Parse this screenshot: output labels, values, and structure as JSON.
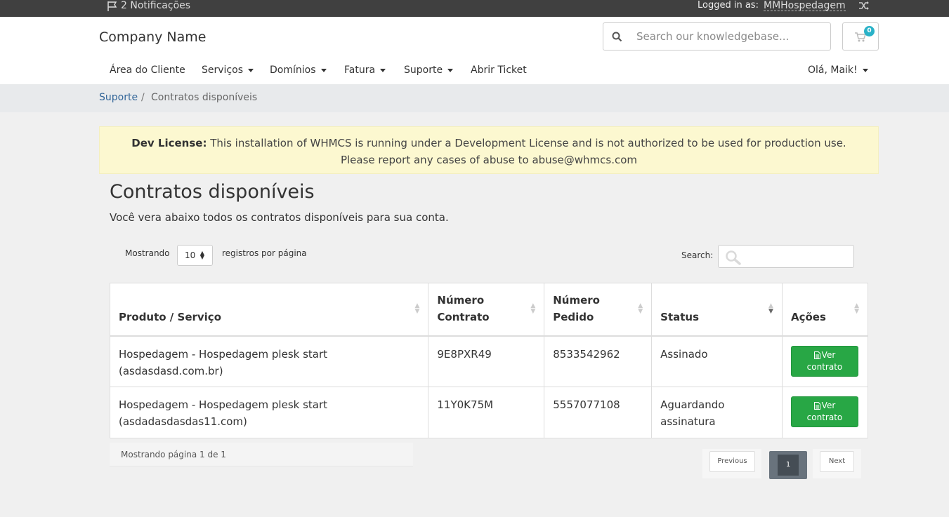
{
  "topbar": {
    "notifications": "2 Notificações",
    "logged_in_as": "Logged in as:",
    "username": "MMHospedagem"
  },
  "header": {
    "brand": "Company Name",
    "search_placeholder": "Search our knowledgebase...",
    "cart_count": "0"
  },
  "nav": {
    "items": [
      {
        "label": "Área do Cliente"
      },
      {
        "label": "Serviços"
      },
      {
        "label": "Domínios"
      },
      {
        "label": "Fatura"
      },
      {
        "label": "Suporte"
      },
      {
        "label": "Abrir Ticket"
      }
    ],
    "greeting": "Olá, Maik!"
  },
  "breadcrumb": {
    "parent": "Suporte",
    "separator": "/",
    "current": "Contratos disponíveis"
  },
  "alert": {
    "strong": "Dev License:",
    "line1": "This installation of WHMCS is running under a Development License and is not authorized to be used for production use.",
    "line2": "Please report any cases of abuse to abuse@whmcs.com"
  },
  "page": {
    "title": "Contratos disponíveis",
    "description": "Você vera abaixo todos os contratos disponíveis para sua conta."
  },
  "table_controls": {
    "showing_label": "Mostrando",
    "page_length": "10",
    "per_page_label": "registros por página",
    "search_label": "Search:"
  },
  "table": {
    "columns": [
      {
        "line1": "Produto / Serviço",
        "line2": ""
      },
      {
        "line1": "Número",
        "line2": "Contrato"
      },
      {
        "line1": "Número",
        "line2": "Pedido"
      },
      {
        "line1": "Status",
        "line2": ""
      },
      {
        "line1": "Ações",
        "line2": ""
      }
    ],
    "rows": [
      {
        "product": "Hospedagem - Hospedagem plesk start",
        "domain": "(asdasdasd.com.br)",
        "contract": "9E8PXR49",
        "order": "8533542962",
        "status": "Assinado",
        "action_line1": "Ver",
        "action_line2": "contrato"
      },
      {
        "product": "Hospedagem - Hospedagem plesk start",
        "domain": "(asdadasdasdas11.com)",
        "contract": "11Y0K75M",
        "order": "5557077108",
        "status": "Aguardando assinatura",
        "action_line1": "Ver",
        "action_line2": "contrato"
      }
    ]
  },
  "pagination": {
    "info": "Mostrando página 1 de 1",
    "previous": "Previous",
    "current": "1",
    "next": "Next"
  },
  "colors": {
    "topbar": "#404040",
    "alert_bg": "#fcf8d0",
    "button_green": "#28a745",
    "badge": "#2ab2c8"
  }
}
